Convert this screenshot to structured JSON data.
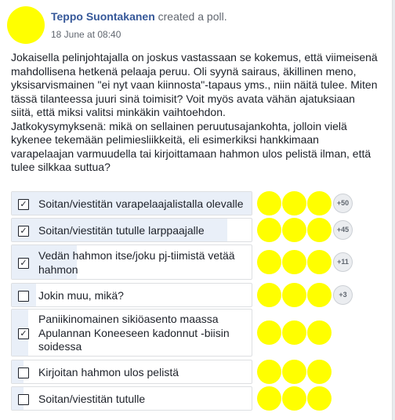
{
  "post": {
    "author": "Teppo Suontakanen",
    "action": "created a poll.",
    "timestamp": "18 June at 08:40",
    "body": "Jokaisella pelinjohtajalla on joskus vastassaan se kokemus, että viimeisenä\nmahdollisena hetkenä pelaaja peruu. Oli syynä sairaus, äkillinen meno,\nyksisarvismainen \"ei nyt vaan kiinnosta\"-tapaus yms., niin näitä tulee. Miten\ntässä tilanteessa juuri sinä toimisit? Voit myös avata vähän ajatuksiaan\nsiitä, että miksi valitsi minkäkin vaihtoehdon.\nJatkokysymyksenä: mikä on sellainen peruutusajankohta, jolloin vielä\nkykenee tekemään pelimiesliikkeitä, eli esimerkiksi hankkimaan\nvarapelaajan varmuudella tai kirjoittamaan hahmon ulos pelistä ilman, että\ntulee silkkaa suttua?"
  },
  "poll": {
    "options": [
      {
        "label": "Soitan/viestitän varapelaajalistalla olevalle",
        "checked": true,
        "check_glyph": "☑",
        "fill_pct": 100,
        "voters_shown": 3,
        "more": "+50"
      },
      {
        "label": "Soitan/viestitän tutulle larppaajalle",
        "checked": true,
        "check_glyph": "☑",
        "fill_pct": 90,
        "voters_shown": 3,
        "more": "+45"
      },
      {
        "label": "Vedän hahmon itse/joku pj-tiimistä vetää hahmon",
        "checked": true,
        "check_glyph": "☑",
        "fill_pct": 27,
        "voters_shown": 3,
        "more": "+11"
      },
      {
        "label": "Jokin muu, mikä?",
        "checked": false,
        "check_glyph": "",
        "fill_pct": 10,
        "voters_shown": 3,
        "more": "+3"
      },
      {
        "label": "Paniikinomainen sikiöasento maassa Apulannan Koneeseen kadonnut -biisin soidessa",
        "checked": true,
        "check_glyph": "☑",
        "fill_pct": 7,
        "voters_shown": 3,
        "more": ""
      },
      {
        "label": "Kirjoitan hahmon ulos pelistä",
        "checked": false,
        "check_glyph": "",
        "fill_pct": 5,
        "voters_shown": 3,
        "more": ""
      },
      {
        "label": "Soitan/viestitän tutulle",
        "checked": false,
        "check_glyph": "",
        "fill_pct": 5,
        "voters_shown": 3,
        "more": ""
      }
    ]
  },
  "colors": {
    "avatar": "#ffff00",
    "author_link": "#365899",
    "vote_fill": "#e9eff8"
  },
  "icons": [
    "checkbox-icon",
    "avatar-icon"
  ]
}
